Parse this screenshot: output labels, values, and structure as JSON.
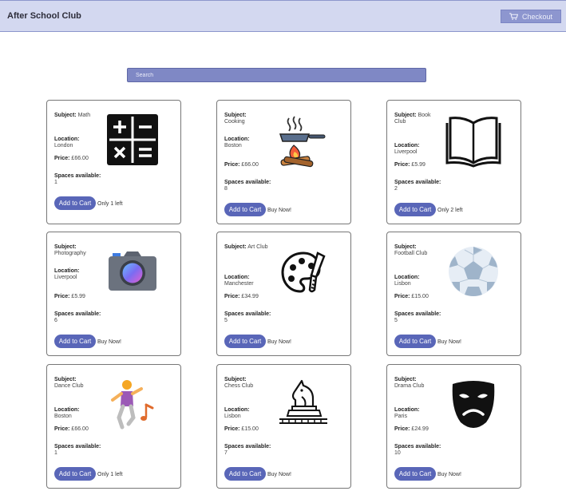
{
  "header": {
    "title": "After School Club",
    "checkout_label": "Checkout"
  },
  "search": {
    "placeholder": "Search"
  },
  "labels": {
    "subject": "Subject:",
    "location": "Location:",
    "price": "Price:",
    "spaces": "Spaces available:",
    "add_to_cart": "Add to Cart"
  },
  "clubs": [
    {
      "subject": "Math",
      "location": "London",
      "price": "£66.00",
      "spaces": "1",
      "stock": "Only 1 left",
      "icon": "calculator-icon"
    },
    {
      "subject": "Cooking",
      "location": "Boston",
      "price": "£66.00",
      "spaces": "8",
      "stock": "Buy Now!",
      "icon": "cooking-pan-icon"
    },
    {
      "subject": "Book Club",
      "location": "Liverpool",
      "price": "£5.99",
      "spaces": "2",
      "stock": "Only 2 left",
      "icon": "open-book-icon"
    },
    {
      "subject": "Photography",
      "location": "Liverpool",
      "price": "£5.99",
      "spaces": "6",
      "stock": "Buy Now!",
      "icon": "camera-icon"
    },
    {
      "subject": "Art Club",
      "location": "Manchester",
      "price": "£34.99",
      "spaces": "5",
      "stock": "Buy Now!",
      "icon": "palette-icon"
    },
    {
      "subject": "Football Club",
      "location": "Lisbon",
      "price": "£15.00",
      "spaces": "5",
      "stock": "Buy Now!",
      "icon": "soccer-ball-icon"
    },
    {
      "subject": "Dance Club",
      "location": "Boston",
      "price": "£66.00",
      "spaces": "1",
      "stock": "Only 1 left",
      "icon": "dancer-icon"
    },
    {
      "subject": "Chess Club",
      "location": "Lisbon",
      "price": "£15.00",
      "spaces": "7",
      "stock": "Buy Now!",
      "icon": "chess-knight-icon"
    },
    {
      "subject": "Drama Club",
      "location": "Paris",
      "price": "£24.99",
      "spaces": "10",
      "stock": "Buy Now!",
      "icon": "drama-mask-icon"
    }
  ]
}
